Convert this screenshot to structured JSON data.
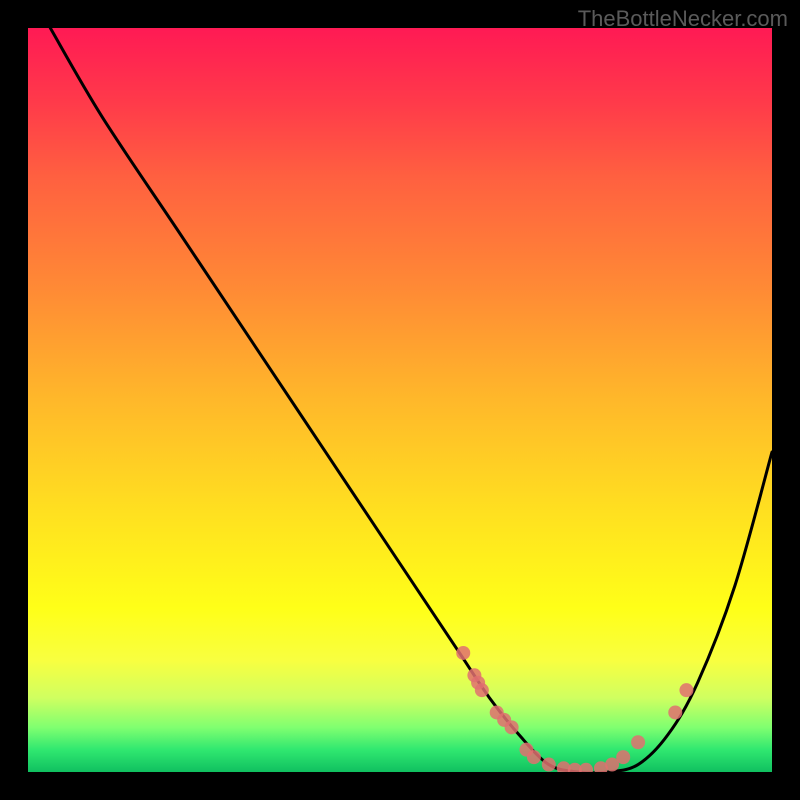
{
  "watermark": "TheBottleNecker.com",
  "chart_data": {
    "type": "line",
    "title": "",
    "xlabel": "",
    "ylabel": "",
    "xlim": [
      0,
      100
    ],
    "ylim": [
      0,
      100
    ],
    "series": [
      {
        "name": "bottleneck-curve",
        "x": [
          3,
          10,
          20,
          30,
          40,
          50,
          58,
          62,
          66,
          70,
          74,
          78,
          82,
          86,
          90,
          95,
          100
        ],
        "y": [
          100,
          88,
          73,
          58,
          43,
          28,
          16,
          10,
          5,
          1,
          0,
          0,
          1,
          5,
          12,
          25,
          43
        ]
      }
    ],
    "markers": {
      "name": "data-points",
      "x": [
        58.5,
        60,
        60.5,
        61,
        63,
        64,
        65,
        67,
        68,
        70,
        72,
        73.5,
        75,
        77,
        78.5,
        80,
        82,
        87,
        88.5
      ],
      "y": [
        16,
        13,
        12,
        11,
        8,
        7,
        6,
        3,
        2,
        1,
        0.5,
        0.3,
        0.3,
        0.5,
        1,
        2,
        4,
        8,
        11
      ]
    },
    "gradient_stops": [
      {
        "pos": 0,
        "color": "#ff1a54"
      },
      {
        "pos": 50,
        "color": "#ffb82a"
      },
      {
        "pos": 78,
        "color": "#ffff18"
      },
      {
        "pos": 100,
        "color": "#10c060"
      }
    ],
    "marker_color": "#e07070",
    "curve_color": "#000000"
  }
}
